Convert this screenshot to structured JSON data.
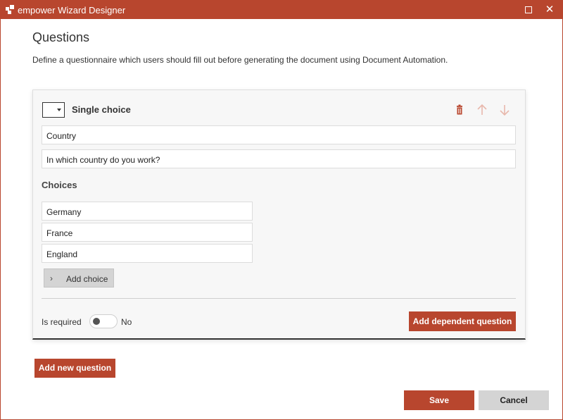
{
  "window": {
    "title": "empower Wizard Designer",
    "accent_color": "#b8462e",
    "controls": [
      "maximize-icon",
      "close-icon"
    ],
    "close_glyph": "✕"
  },
  "page": {
    "title": "Questions",
    "description": "Define a questionnaire which users should fill out before generating the document using Document Automation."
  },
  "question": {
    "type_label": "Single choice",
    "name_value": "Country",
    "question_value": "In which country do you work?",
    "actions": [
      "trash-icon",
      "arrow-up-icon",
      "arrow-down-icon"
    ],
    "choices_heading": "Choices",
    "choices": [
      "Germany",
      "France",
      "England"
    ],
    "add_choice_label": "Add choice",
    "add_choice_glyph": "›",
    "required_label": "Is required",
    "required_value": "No",
    "required_on": false,
    "add_dependent_label": "Add dependent question"
  },
  "footer": {
    "add_question_label": "Add new question",
    "save_label": "Save",
    "cancel_label": "Cancel"
  }
}
